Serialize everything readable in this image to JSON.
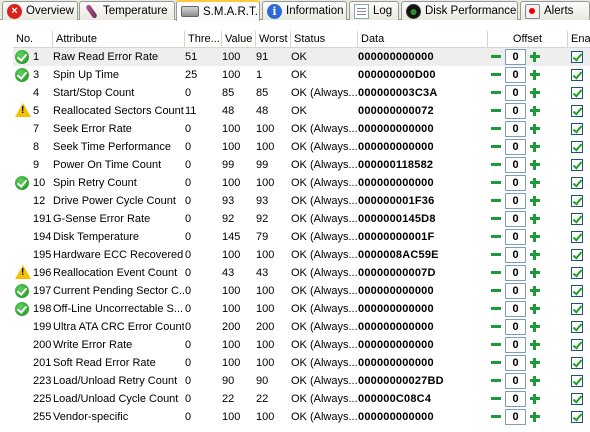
{
  "tabs": [
    {
      "label": "Overview",
      "icon": "overview-icon"
    },
    {
      "label": "Temperature",
      "icon": "thermometer-icon"
    },
    {
      "label": "S.M.A.R.T.",
      "icon": "drive-icon"
    },
    {
      "label": "Information",
      "icon": "info-icon"
    },
    {
      "label": "Log",
      "icon": "log-icon"
    },
    {
      "label": "Disk Performance",
      "icon": "performance-icon"
    },
    {
      "label": "Alerts",
      "icon": "alerts-icon"
    }
  ],
  "columns": {
    "no": "No.",
    "attribute": "Attribute",
    "threshold": "Thre...",
    "value": "Value",
    "worst": "Worst",
    "status": "Status",
    "data": "Data",
    "offset": "Offset",
    "enable": "Enable"
  },
  "rows": [
    {
      "icon": "good",
      "no": "1",
      "attribute": "Raw Read Error Rate",
      "threshold": "51",
      "value": "100",
      "worst": "91",
      "status": "OK",
      "data": "000000000000",
      "offset": "0",
      "enabled": true
    },
    {
      "icon": "good",
      "no": "3",
      "attribute": "Spin Up Time",
      "threshold": "25",
      "value": "100",
      "worst": "1",
      "status": "OK",
      "data": "000000000D00",
      "offset": "0",
      "enabled": true
    },
    {
      "icon": "",
      "no": "4",
      "attribute": "Start/Stop Count",
      "threshold": "0",
      "value": "85",
      "worst": "85",
      "status": "OK (Always...",
      "data": "000000003C3A",
      "offset": "0",
      "enabled": true
    },
    {
      "icon": "warn",
      "no": "5",
      "attribute": "Reallocated Sectors Count",
      "threshold": "11",
      "value": "48",
      "worst": "48",
      "status": "OK",
      "data": "000000000072",
      "offset": "0",
      "enabled": true
    },
    {
      "icon": "",
      "no": "7",
      "attribute": "Seek Error Rate",
      "threshold": "0",
      "value": "100",
      "worst": "100",
      "status": "OK (Always...",
      "data": "000000000000",
      "offset": "0",
      "enabled": true
    },
    {
      "icon": "",
      "no": "8",
      "attribute": "Seek Time Performance",
      "threshold": "0",
      "value": "100",
      "worst": "100",
      "status": "OK (Always...",
      "data": "000000000000",
      "offset": "0",
      "enabled": true
    },
    {
      "icon": "",
      "no": "9",
      "attribute": "Power On Time Count",
      "threshold": "0",
      "value": "99",
      "worst": "99",
      "status": "OK (Always...",
      "data": "000000118582",
      "offset": "0",
      "enabled": true
    },
    {
      "icon": "good",
      "no": "10",
      "attribute": "Spin Retry Count",
      "threshold": "0",
      "value": "100",
      "worst": "100",
      "status": "OK (Always...",
      "data": "000000000000",
      "offset": "0",
      "enabled": true
    },
    {
      "icon": "",
      "no": "12",
      "attribute": "Drive Power Cycle Count",
      "threshold": "0",
      "value": "93",
      "worst": "93",
      "status": "OK (Always...",
      "data": "000000001F36",
      "offset": "0",
      "enabled": true
    },
    {
      "icon": "",
      "no": "191",
      "attribute": "G-Sense Error Rate",
      "threshold": "0",
      "value": "92",
      "worst": "92",
      "status": "OK (Always...",
      "data": "0000000145D8",
      "offset": "0",
      "enabled": true
    },
    {
      "icon": "",
      "no": "194",
      "attribute": "Disk Temperature",
      "threshold": "0",
      "value": "145",
      "worst": "79",
      "status": "OK (Always...",
      "data": "00000000001F",
      "offset": "0",
      "enabled": true
    },
    {
      "icon": "",
      "no": "195",
      "attribute": "Hardware ECC Recovered",
      "threshold": "0",
      "value": "100",
      "worst": "100",
      "status": "OK (Always...",
      "data": "0000008AC59E",
      "offset": "0",
      "enabled": true
    },
    {
      "icon": "warn",
      "no": "196",
      "attribute": "Reallocation Event Count",
      "threshold": "0",
      "value": "43",
      "worst": "43",
      "status": "OK (Always...",
      "data": "00000000007D",
      "offset": "0",
      "enabled": true
    },
    {
      "icon": "good",
      "no": "197",
      "attribute": "Current Pending Sector C...",
      "threshold": "0",
      "value": "100",
      "worst": "100",
      "status": "OK (Always...",
      "data": "000000000000",
      "offset": "0",
      "enabled": true
    },
    {
      "icon": "good",
      "no": "198",
      "attribute": "Off-Line Uncorrectable S...",
      "threshold": "0",
      "value": "100",
      "worst": "100",
      "status": "OK (Always...",
      "data": "000000000000",
      "offset": "0",
      "enabled": true
    },
    {
      "icon": "",
      "no": "199",
      "attribute": "Ultra ATA CRC Error Count",
      "threshold": "0",
      "value": "200",
      "worst": "200",
      "status": "OK (Always...",
      "data": "000000000000",
      "offset": "0",
      "enabled": true
    },
    {
      "icon": "",
      "no": "200",
      "attribute": "Write Error Rate",
      "threshold": "0",
      "value": "100",
      "worst": "100",
      "status": "OK (Always...",
      "data": "000000000000",
      "offset": "0",
      "enabled": true
    },
    {
      "icon": "",
      "no": "201",
      "attribute": "Soft Read Error Rate",
      "threshold": "0",
      "value": "100",
      "worst": "100",
      "status": "OK (Always...",
      "data": "000000000000",
      "offset": "0",
      "enabled": true
    },
    {
      "icon": "",
      "no": "223",
      "attribute": "Load/Unload Retry Count",
      "threshold": "0",
      "value": "90",
      "worst": "90",
      "status": "OK (Always...",
      "data": "00000000027BD",
      "offset": "0",
      "enabled": true
    },
    {
      "icon": "",
      "no": "225",
      "attribute": "Load/Unload Cycle Count",
      "threshold": "0",
      "value": "22",
      "worst": "22",
      "status": "OK (Always...",
      "data": "000000C08C4",
      "offset": "0",
      "enabled": true
    },
    {
      "icon": "",
      "no": "255",
      "attribute": "Vendor-specific",
      "threshold": "0",
      "value": "100",
      "worst": "100",
      "status": "OK (Always...",
      "data": "000000000000",
      "offset": "0",
      "enabled": true
    }
  ]
}
